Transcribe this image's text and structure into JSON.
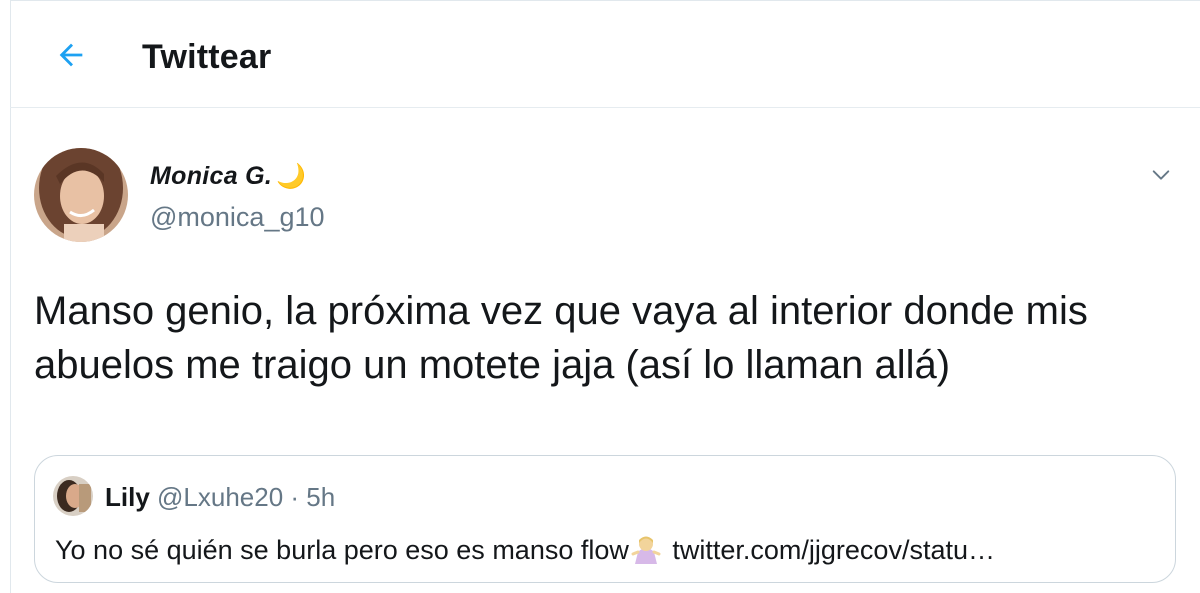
{
  "header": {
    "title": "Twittear",
    "back_icon": "arrow-left-icon",
    "accent_color": "#1da1f2"
  },
  "tweet": {
    "author": {
      "display_name": "Monica G.",
      "moon": "🌙",
      "handle": "@monica_g10",
      "avatar_icon": "user-avatar"
    },
    "menu_icon": "chevron-down-icon",
    "text": "Manso genio, la próxima vez que vaya al interior donde mis abuelos me traigo un motete jaja (así lo llaman allá)"
  },
  "quoted_tweet": {
    "author": {
      "display_name": "Lily",
      "handle": "@Lxuhe20",
      "separator": " · ",
      "time": "5h",
      "avatar_icon": "user-avatar"
    },
    "text_before": "Yo no sé quién se burla pero eso es manso flow",
    "emoji_icon": "person-shrugging-emoji",
    "text_after": " twitter.com/jjgrecov/statu…"
  },
  "colors": {
    "text": "#14171a",
    "secondary": "#657786",
    "border": "#ccd6dd"
  }
}
